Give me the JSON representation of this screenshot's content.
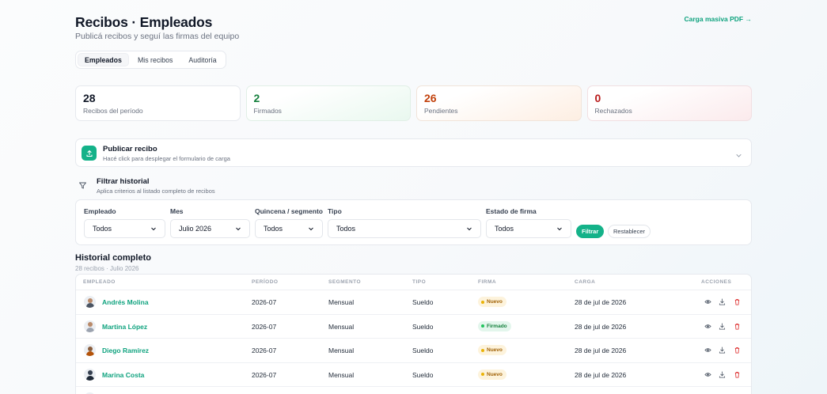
{
  "header": {
    "title": "Recibos · Empleados",
    "subtitle": "Publicá recibos y seguí las firmas del equipo",
    "bulk_link": "Carga masiva PDF →"
  },
  "tabs": [
    {
      "label": "Empleados",
      "active": true
    },
    {
      "label": "Mis recibos",
      "active": false
    },
    {
      "label": "Auditoría",
      "active": false
    }
  ],
  "stats": [
    {
      "value": "28",
      "label": "Recibos del período"
    },
    {
      "value": "2",
      "label": "Firmados"
    },
    {
      "value": "26",
      "label": "Pendientes"
    },
    {
      "value": "0",
      "label": "Rechazados"
    }
  ],
  "publish": {
    "title": "Publicar recibo",
    "description": "Hacé click para desplegar el formulario de carga"
  },
  "filter": {
    "title": "Filtrar historial",
    "description": "Aplica criterios al listado completo de recibos",
    "fields": [
      {
        "label": "Empleado",
        "value": "Todos"
      },
      {
        "label": "Mes",
        "value": "Julio 2026"
      },
      {
        "label": "Quincena / segmento",
        "value": "Todos"
      },
      {
        "label": "Tipo",
        "value": "Todos"
      },
      {
        "label": "Estado de firma",
        "value": "Todos"
      }
    ],
    "apply_label": "Filtrar",
    "reset_label": "Restablecer"
  },
  "history": {
    "title": "Historial completo",
    "subtitle": "28 recibos · Julio 2026",
    "columns": [
      "EMPLEADO",
      "PERÍODO",
      "SEGMENTO",
      "TIPO",
      "FIRMA",
      "CARGA",
      "ACCIONES"
    ],
    "rows": [
      {
        "employee": "Andrés Molina",
        "period": "2026-07",
        "segment": "Mensual",
        "type": "Sueldo",
        "status": "Nuevo",
        "uploaded": "28 de jul de 2026"
      },
      {
        "employee": "Martina López",
        "period": "2026-07",
        "segment": "Mensual",
        "type": "Sueldo",
        "status": "Firmado",
        "uploaded": "28 de jul de 2026"
      },
      {
        "employee": "Diego Ramírez",
        "period": "2026-07",
        "segment": "Mensual",
        "type": "Sueldo",
        "status": "Nuevo",
        "uploaded": "28 de jul de 2026"
      },
      {
        "employee": "Marina Costa",
        "period": "2026-07",
        "segment": "Mensual",
        "type": "Sueldo",
        "status": "Nuevo",
        "uploaded": "28 de jul de 2026"
      }
    ]
  },
  "colors": {
    "accent": "#14b289",
    "link": "#10a37f",
    "firmado": "#22c55e",
    "nuevo": "#eab308",
    "danger": "#dc2626"
  },
  "icons": {
    "upload": "upload-icon",
    "filter": "filter-icon",
    "chevron": "chevron-down-icon",
    "view": "eye-icon",
    "download": "download-icon",
    "delete": "trash-icon"
  }
}
